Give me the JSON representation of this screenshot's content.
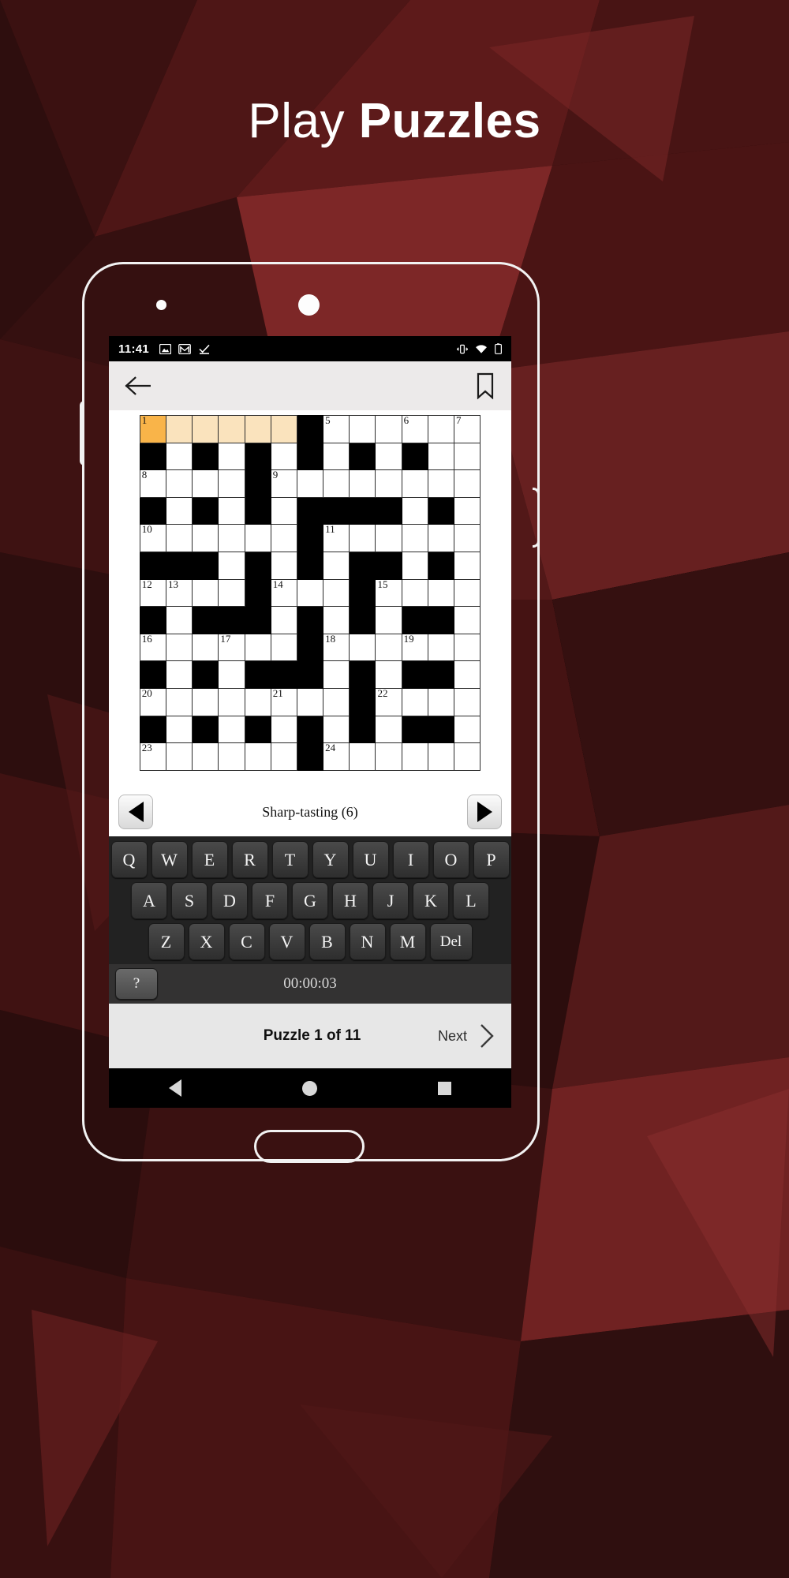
{
  "headline": {
    "light": "Play ",
    "bold": "Puzzles"
  },
  "colors": {
    "bg_dark": "#2a0d0d",
    "bg_mid": "#4a1515",
    "bg_accent": "#8c3030",
    "cell_current": "#f9b449",
    "cell_highlight": "#fae3bd",
    "appbar": "#eceaea",
    "keyboard_bg": "#222222",
    "actionbar": "#e7e7e7"
  },
  "statusbar": {
    "time": "11:41",
    "left_icons": [
      "image-icon",
      "gmail-icon",
      "check-inbox-icon"
    ],
    "right_icons": [
      "vibrate-icon",
      "wifi-icon",
      "battery-icon"
    ]
  },
  "appbar": {
    "back_icon": "arrow-left-icon",
    "bookmark_icon": "bookmark-icon"
  },
  "puzzle": {
    "clue": "Sharp-tasting (6)",
    "prev_label": "prev-clue",
    "next_label": "next-clue",
    "timer": "00:00:03",
    "help_key": "?",
    "rows": 13,
    "cols": 13,
    "grid": [
      [
        "c1",
        "h",
        "h",
        "h",
        "h",
        "h",
        "B",
        "5",
        "o",
        "o",
        "6",
        "o",
        "7"
      ],
      [
        "B",
        "o",
        "B",
        "o",
        "B",
        "o",
        "B",
        "o",
        "B",
        "o",
        "B",
        "o",
        "o"
      ],
      [
        "8",
        "o",
        "o",
        "o",
        "B",
        "9",
        "o",
        "o",
        "o",
        "o",
        "o",
        "o",
        "o"
      ],
      [
        "B",
        "o",
        "B",
        "o",
        "B",
        "o",
        "B",
        "B",
        "B",
        "B",
        "o",
        "B",
        "o"
      ],
      [
        "10",
        "o",
        "o",
        "o",
        "o",
        "o",
        "B",
        "11",
        "o",
        "o",
        "o",
        "o",
        "o"
      ],
      [
        "B",
        "B",
        "B",
        "o",
        "B",
        "o",
        "B",
        "o",
        "B",
        "B",
        "o",
        "B",
        "o"
      ],
      [
        "12",
        "13",
        "o",
        "o",
        "B",
        "14",
        "o",
        "o",
        "B",
        "15",
        "o",
        "o",
        "o"
      ],
      [
        "B",
        "o",
        "B",
        "B",
        "B",
        "o",
        "B",
        "o",
        "B",
        "o",
        "B",
        "B",
        "o"
      ],
      [
        "16",
        "o",
        "o",
        "17",
        "o",
        "o",
        "B",
        "18",
        "o",
        "o",
        "19",
        "o",
        "o"
      ],
      [
        "B",
        "o",
        "B",
        "o",
        "B",
        "B",
        "B",
        "o",
        "B",
        "o",
        "B",
        "B",
        "o"
      ],
      [
        "20",
        "o",
        "o",
        "o",
        "o",
        "21",
        "o",
        "o",
        "B",
        "22",
        "o",
        "o",
        "o"
      ],
      [
        "B",
        "o",
        "B",
        "o",
        "B",
        "o",
        "B",
        "o",
        "B",
        "o",
        "B",
        "B",
        "o"
      ],
      [
        "23",
        "o",
        "o",
        "o",
        "o",
        "o",
        "B",
        "24",
        "o",
        "o",
        "o",
        "o",
        "o"
      ]
    ]
  },
  "keyboard": {
    "row1": [
      "Q",
      "W",
      "E",
      "R",
      "T",
      "Y",
      "U",
      "I",
      "O",
      "P"
    ],
    "row2": [
      "A",
      "S",
      "D",
      "F",
      "G",
      "H",
      "J",
      "K",
      "L"
    ],
    "row3": [
      "Z",
      "X",
      "C",
      "V",
      "B",
      "N",
      "M"
    ],
    "delete": "Del"
  },
  "actionbar": {
    "puzzle_count": "Puzzle 1 of 11",
    "next": "Next",
    "next_icon": "chevron-right-icon"
  },
  "android_nav": {
    "back": "back-triangle-icon",
    "home": "home-circle-icon",
    "recents": "recents-square-icon"
  }
}
